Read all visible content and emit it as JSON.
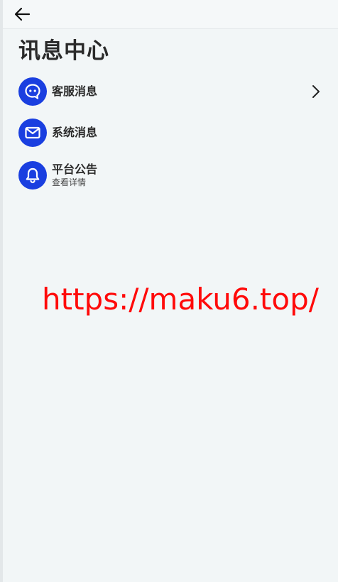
{
  "header": {
    "back_icon": "arrow-left-icon"
  },
  "page": {
    "title": "讯息中心"
  },
  "messages": [
    {
      "label": "客服消息",
      "icon": "chatbot-icon",
      "has_chevron": true
    },
    {
      "label": "系统消息",
      "icon": "mail-icon"
    },
    {
      "label": "平台公告",
      "sub": "查看详情",
      "icon": "bell-icon"
    }
  ],
  "watermark": {
    "text": "https://maku6.top/"
  },
  "colors": {
    "icon_bg": "#1a3fe0",
    "watermark": "#ff0a0a",
    "background": "#f2f6f7"
  }
}
